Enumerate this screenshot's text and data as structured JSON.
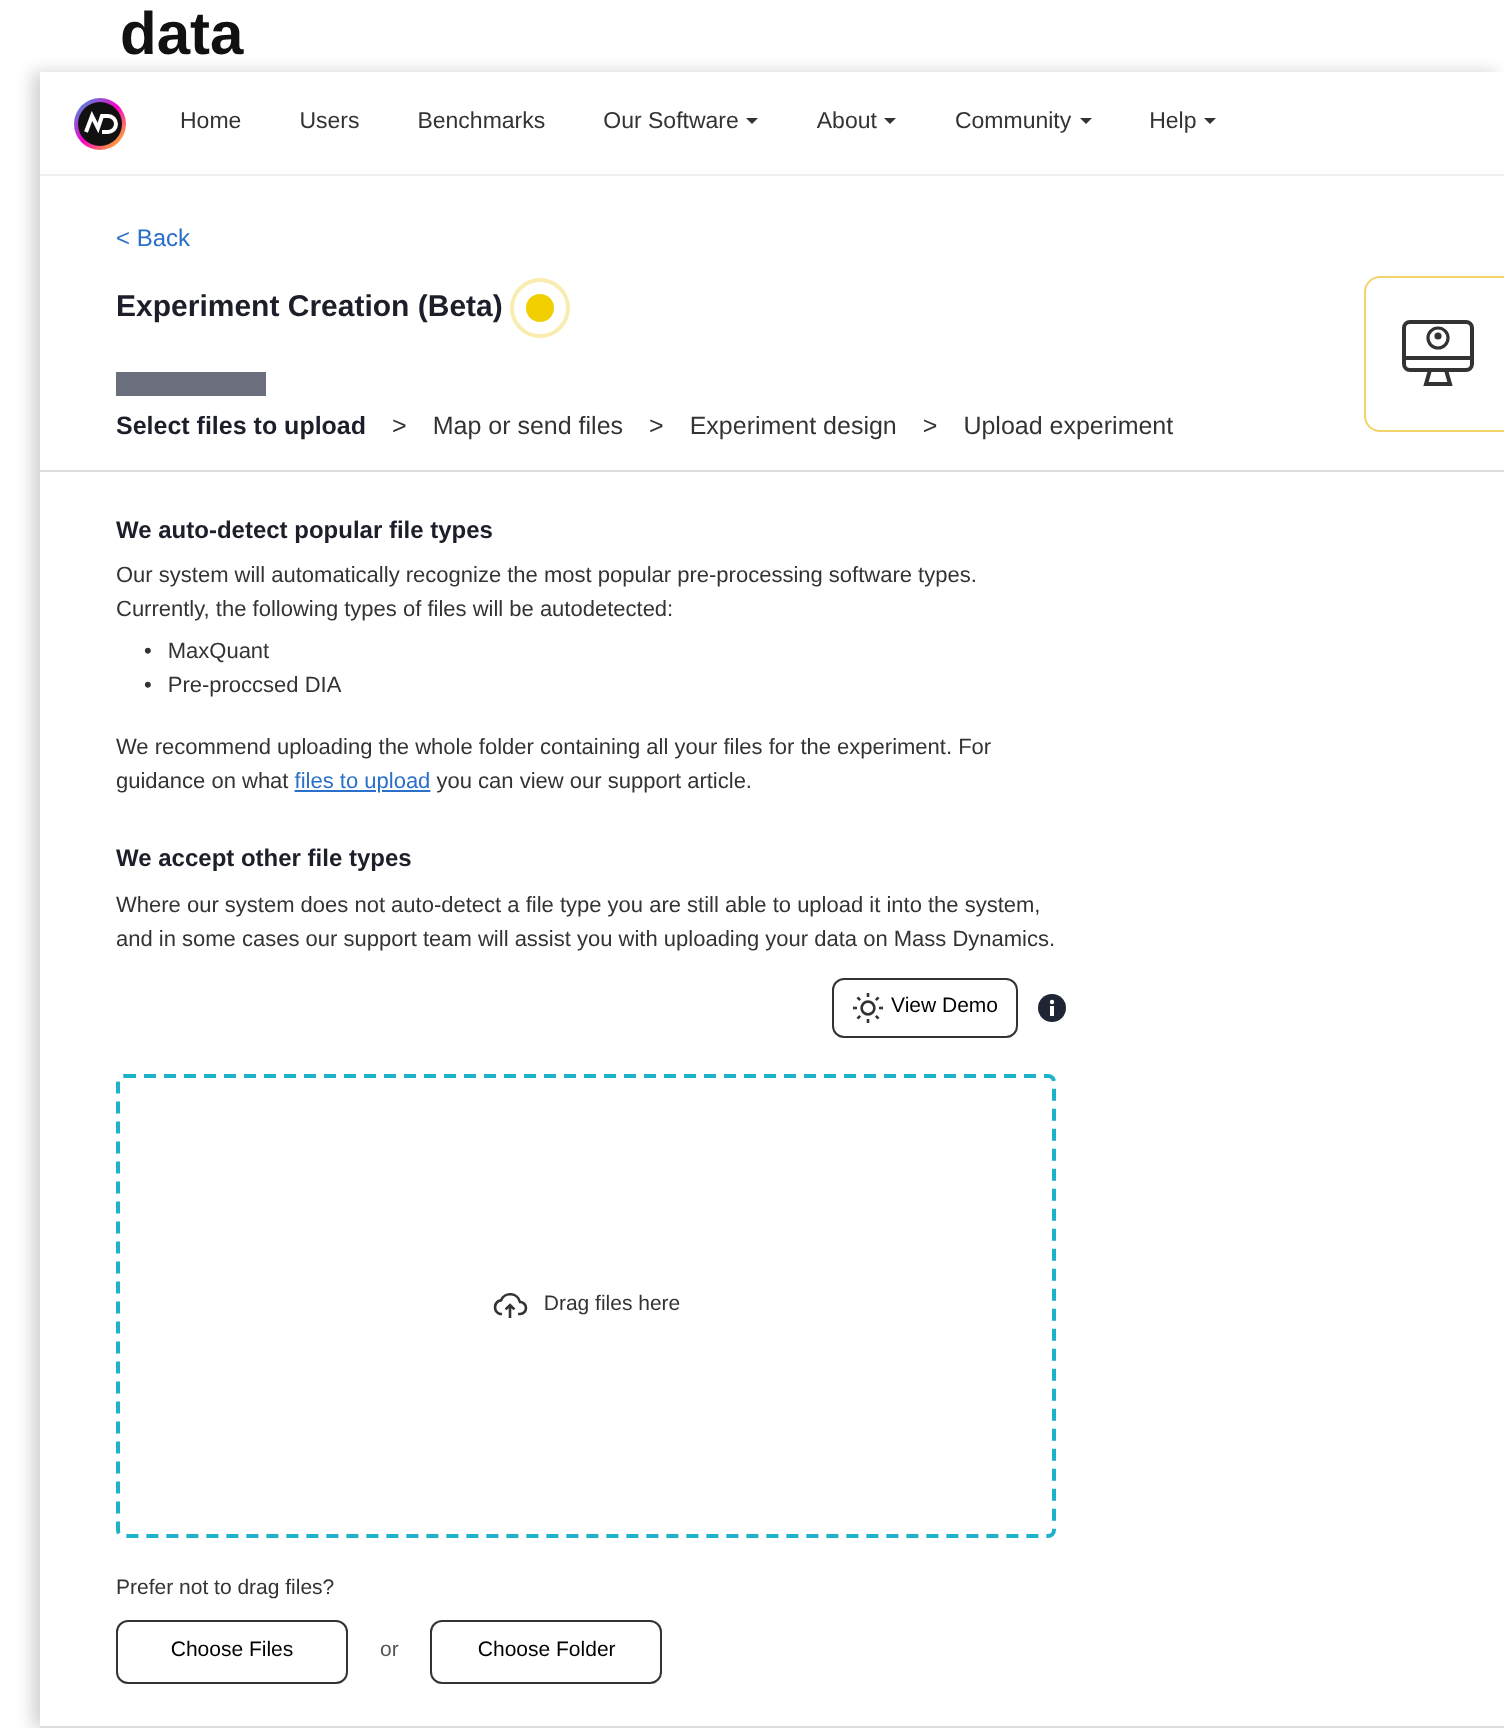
{
  "page_heading": "data",
  "navbar": {
    "items": [
      {
        "label": "Home",
        "dropdown": false
      },
      {
        "label": "Users",
        "dropdown": false
      },
      {
        "label": "Benchmarks",
        "dropdown": false
      },
      {
        "label": "Our Software",
        "dropdown": true
      },
      {
        "label": "About",
        "dropdown": true
      },
      {
        "label": "Community",
        "dropdown": true
      },
      {
        "label": "Help",
        "dropdown": true
      }
    ]
  },
  "back_link": "< Back",
  "title": "Experiment Creation (Beta)",
  "steps": [
    {
      "label": "Select files to upload",
      "selected": true
    },
    {
      "label": "Map or send files",
      "selected": false
    },
    {
      "label": "Experiment design",
      "selected": false
    },
    {
      "label": "Upload experiment",
      "selected": false
    }
  ],
  "step_separator": ">",
  "sections": [
    {
      "heading": "We auto-detect popular file types",
      "paragraphs": [
        "Our system will automatically recognize the most popular pre-processing software types. Currently, the following types of files will be autodetected:"
      ],
      "bullet_marker": "•",
      "bullets": [
        "MaxQuant",
        "Pre-proccsed DIA"
      ],
      "after": {
        "before_link": "We recommend uploading the whole folder containing all your files for the experiment. For guidance on what ",
        "link": "files to upload",
        "after_link": " you can view our support article."
      }
    },
    {
      "heading": "We accept other file types",
      "paragraphs": [
        "Where our system does not auto-detect a file type you are still able to upload it into the system, and in some cases our support team will assist you with uploading your data on Mass Dynamics."
      ]
    }
  ],
  "demo_button": "View Demo",
  "dropzone": {
    "label": "Drag files here"
  },
  "alt_prompt": "Prefer not to drag files?",
  "choose_files": "Choose Files",
  "or": "or",
  "choose_folder": "Choose Folder"
}
